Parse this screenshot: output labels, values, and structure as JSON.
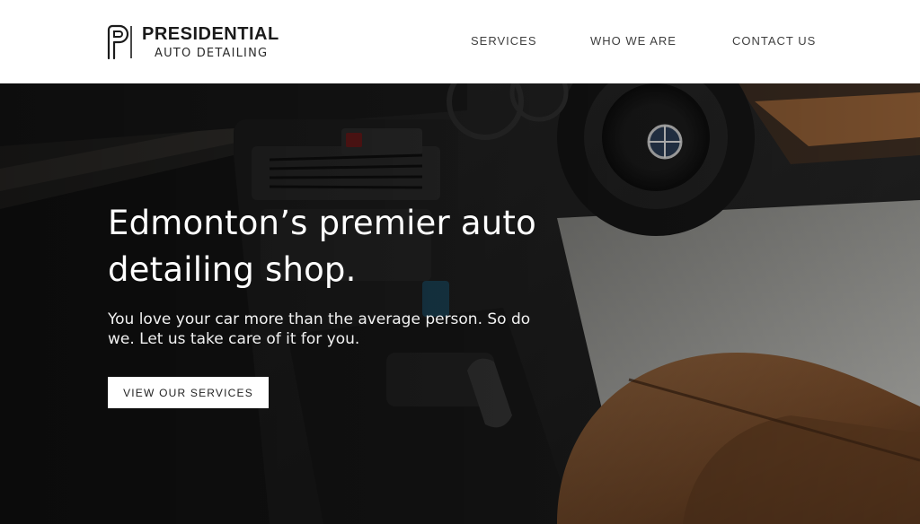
{
  "brand": {
    "name": "PRESIDENTIAL",
    "sub": "AUTO DETAILING"
  },
  "nav": {
    "items": [
      {
        "label": "SERVICES"
      },
      {
        "label": "WHO WE ARE"
      },
      {
        "label": "CONTACT US"
      }
    ]
  },
  "hero": {
    "title": "Edmonton’s premier auto detailing shop.",
    "subtitle": "You love your car more than the average person. So do we. Let us take care of it for you.",
    "cta_label": "VIEW OUR SERVICES"
  },
  "colors": {
    "header_bg": "#ffffff",
    "text_dark": "#1b1b1b",
    "hero_text": "#ffffff",
    "button_bg": "#ffffff",
    "leather": "#8a5a33"
  }
}
